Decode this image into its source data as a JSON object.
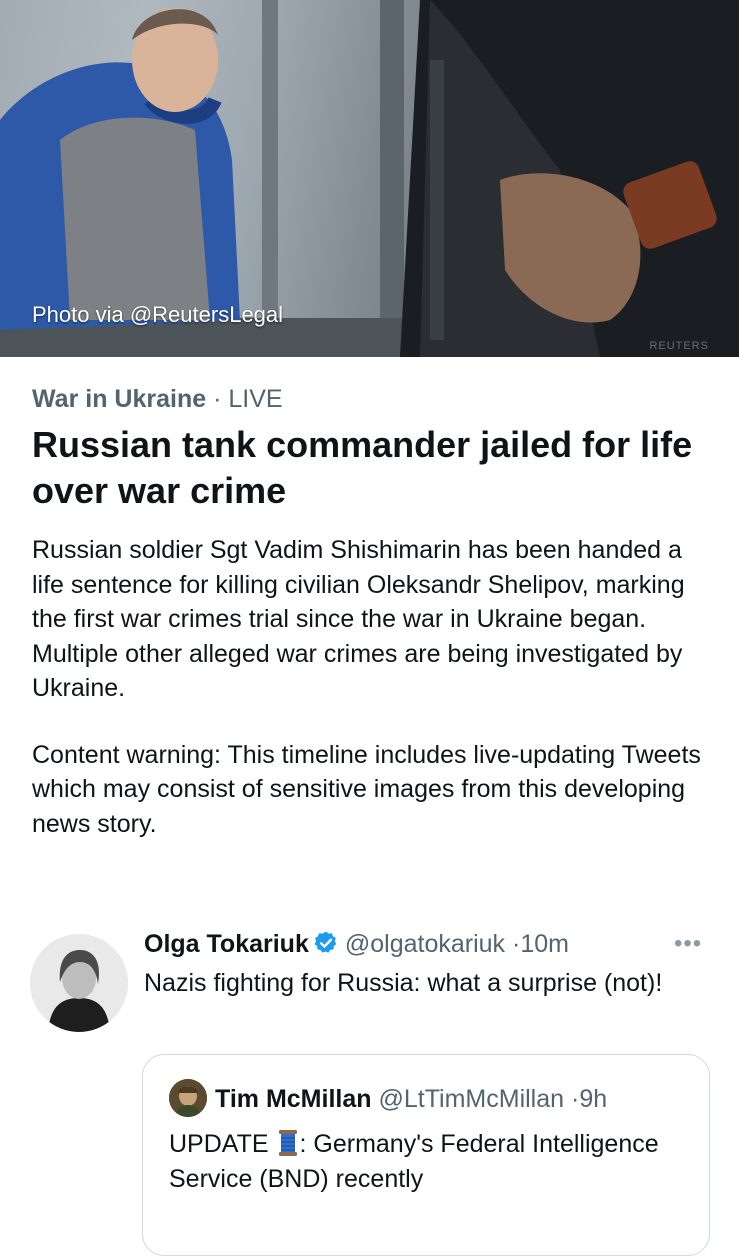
{
  "hero": {
    "photo_credit": "Photo via @ReutersLegal",
    "watermark": "REUTERS"
  },
  "article": {
    "category": "War in Ukraine",
    "separator": "·",
    "status": "LIVE",
    "headline": "Russian tank commander jailed for life over war crime",
    "summary": "Russian soldier Sgt Vadim Shishimarin has been handed a life sentence for killing civilian Oleksandr Shelipov, marking the first war crimes trial since the war in Ukraine began. Multiple other alleged war crimes are being investigated by Ukraine.",
    "content_warning": "Content warning: This timeline includes live-updating Tweets which may consist of sensitive images from this developing news story."
  },
  "tweet": {
    "name": "Olga Tokariuk",
    "handle": "@olgatokariuk",
    "dot": "·",
    "time": "10m",
    "more_icon": "•••",
    "text": "Nazis fighting for Russia: what a surprise (not)!",
    "quote": {
      "name": "Tim McMillan",
      "handle": "@LtTimMcMillan",
      "dot": "·",
      "time": "9h",
      "text_before": "UPDATE",
      "emoji": "spool-of-thread",
      "text_after": ": Germany's Federal Intelligence Service (BND) recently"
    }
  },
  "colors": {
    "text_primary": "#0f1419",
    "text_secondary": "#536471",
    "verified_blue": "#1d9bf0",
    "border": "#cfd9de"
  }
}
